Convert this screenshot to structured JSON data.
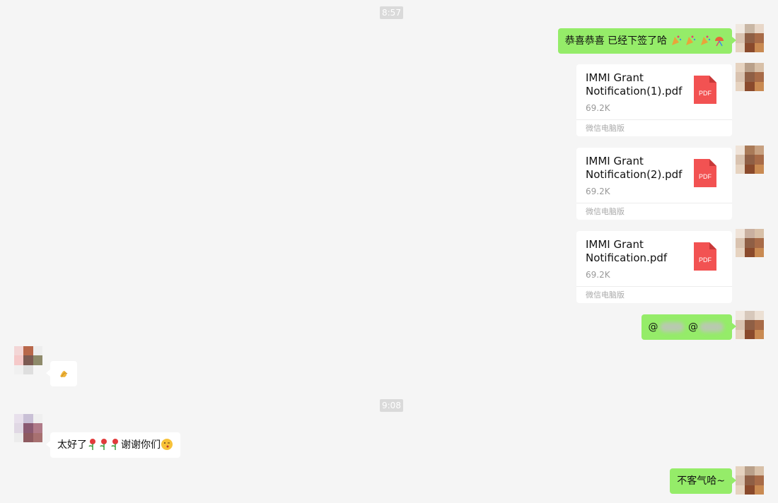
{
  "timestamps": [
    "8:57",
    "9:08"
  ],
  "messages": {
    "congrats": {
      "text": "恭喜恭喜 已经下签了哈"
    },
    "mention": {
      "prefix_1": "@",
      "prefix_2": "@"
    },
    "thanks": {
      "text_1": "太好了",
      "text_2": "谢谢你们"
    },
    "welcome": {
      "text": "不客气哈~"
    }
  },
  "files": [
    {
      "name": "IMMI Grant Notification(1).pdf",
      "size": "69.2K",
      "source": "微信电脑版",
      "icon_label": "PDF",
      "icon": "pdf-file-icon"
    },
    {
      "name": "IMMI Grant Notification(2).pdf",
      "size": "69.2K",
      "source": "微信电脑版",
      "icon_label": "PDF",
      "icon": "pdf-file-icon"
    },
    {
      "name": "IMMI Grant Notification.pdf",
      "size": "69.2K",
      "source": "微信电脑版",
      "icon_label": "PDF",
      "icon": "pdf-file-icon"
    }
  ],
  "emojis": {
    "congrats": [
      "party-popper-icon",
      "party-popper-icon",
      "party-popper-icon",
      "confetti-ball-icon"
    ],
    "reply": [
      "bow-icon"
    ],
    "thanks": [
      "rose-icon",
      "rose-icon",
      "rose-icon",
      "blowing-kiss-icon"
    ]
  },
  "colors": {
    "background": "#f5f5f5",
    "sent_bubble": "#95ec69",
    "received_bubble": "#ffffff",
    "pdf_red": "#f25252",
    "timestamp_bg": "#dadada"
  }
}
